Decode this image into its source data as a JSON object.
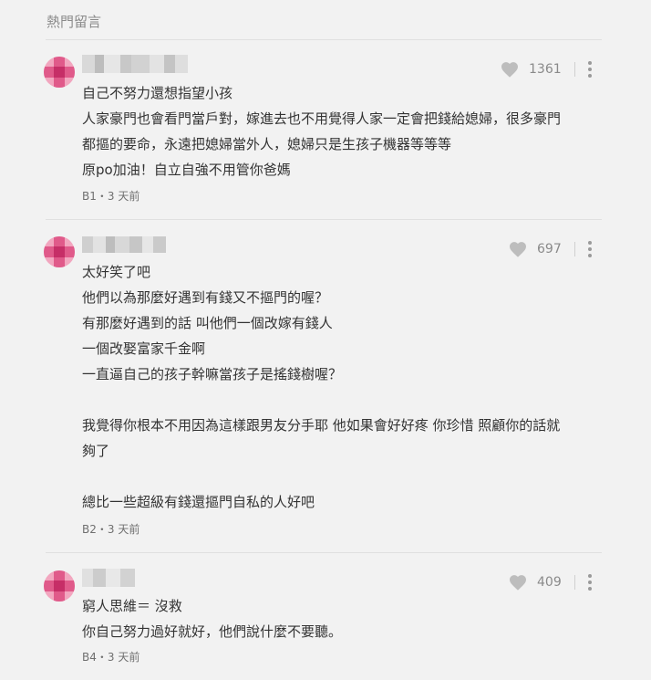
{
  "header": {
    "title": "熱門留言"
  },
  "comments": [
    {
      "likes": "1361",
      "lines": [
        "自己不努力還想指望小孩",
        "人家豪門也會看門當戶對，嫁進去也不用覺得人家一定會把錢給媳婦，很多豪門",
        "都摳的要命，永遠把媳婦當外人，媳婦只是生孩子機器等等等",
        "原po加油！自立自強不用管你爸媽"
      ],
      "floor": "B1・3 天前"
    },
    {
      "likes": "697",
      "lines": [
        "太好笑了吧",
        "他們以為那麼好遇到有錢又不摳門的喔？",
        "有那麼好遇到的話 叫他們一個改嫁有錢人",
        "一個改娶富家千金啊",
        "一直逼自己的孩子幹嘛當孩子是搖錢樹喔？",
        "",
        "我覺得你根本不用因為這樣跟男友分手耶 他如果會好好疼 你珍惜 照顧你的話就",
        "夠了",
        "",
        "總比一些超級有錢還摳門自私的人好吧"
      ],
      "floor": "B2・3 天前"
    },
    {
      "likes": "409",
      "lines": [
        "窮人思維＝ 沒救",
        "你自己努力過好就好，他們說什麼不要聽。"
      ],
      "floor": "B4・3 天前"
    }
  ]
}
